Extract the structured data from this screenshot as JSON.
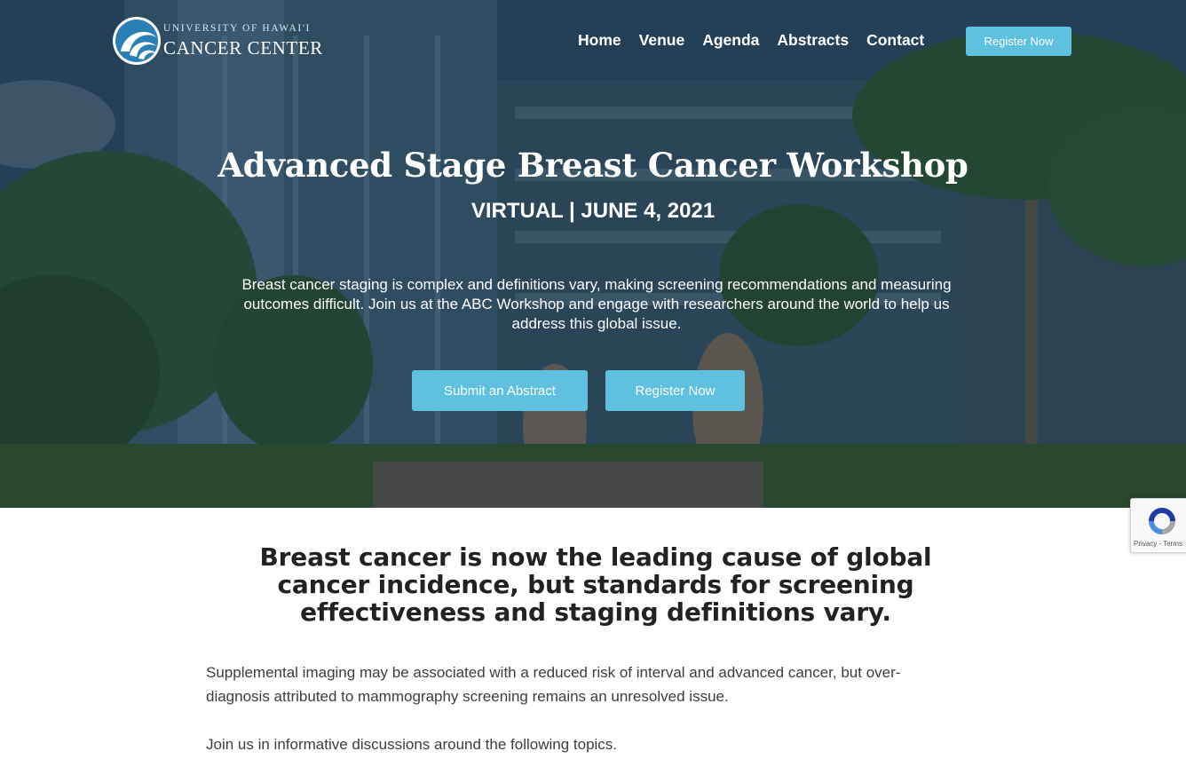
{
  "header": {
    "logo": {
      "line1": "UNIVERSITY OF HAWAI'I",
      "line2": "CANCER CENTER"
    },
    "nav": [
      {
        "label": "Home"
      },
      {
        "label": "Venue"
      },
      {
        "label": "Agenda"
      },
      {
        "label": "Abstracts"
      },
      {
        "label": "Contact"
      }
    ],
    "cta_label": "Register Now"
  },
  "hero": {
    "title": "Advanced Stage Breast Cancer Workshop",
    "subtitle": "VIRTUAL | JUNE 4, 2021",
    "description": "Breast cancer staging is complex and definitions vary, making screening recommendations and measuring outcomes difficult. Join us at the ABC Workshop and engage with researchers around the world to help us address this global issue.",
    "buttons": {
      "submit_abstract": "Submit an Abstract",
      "register": "Register Now"
    }
  },
  "content": {
    "heading": "Breast cancer is now the leading cause of global cancer incidence, but standards for screening effectiveness and staging definitions vary.",
    "paragraph1": "Supplemental imaging may be associated with a reduced risk of interval and advanced cancer, but over-diagnosis attributed to mammography screening remains an unresolved issue.",
    "paragraph2": "Join us in informative discussions around the following topics."
  },
  "recaptcha": {
    "text": "Privacy - Terms"
  },
  "colors": {
    "accent": "#5ec1e0",
    "heading_text": "#222222",
    "body_text": "#3d3d3d"
  }
}
